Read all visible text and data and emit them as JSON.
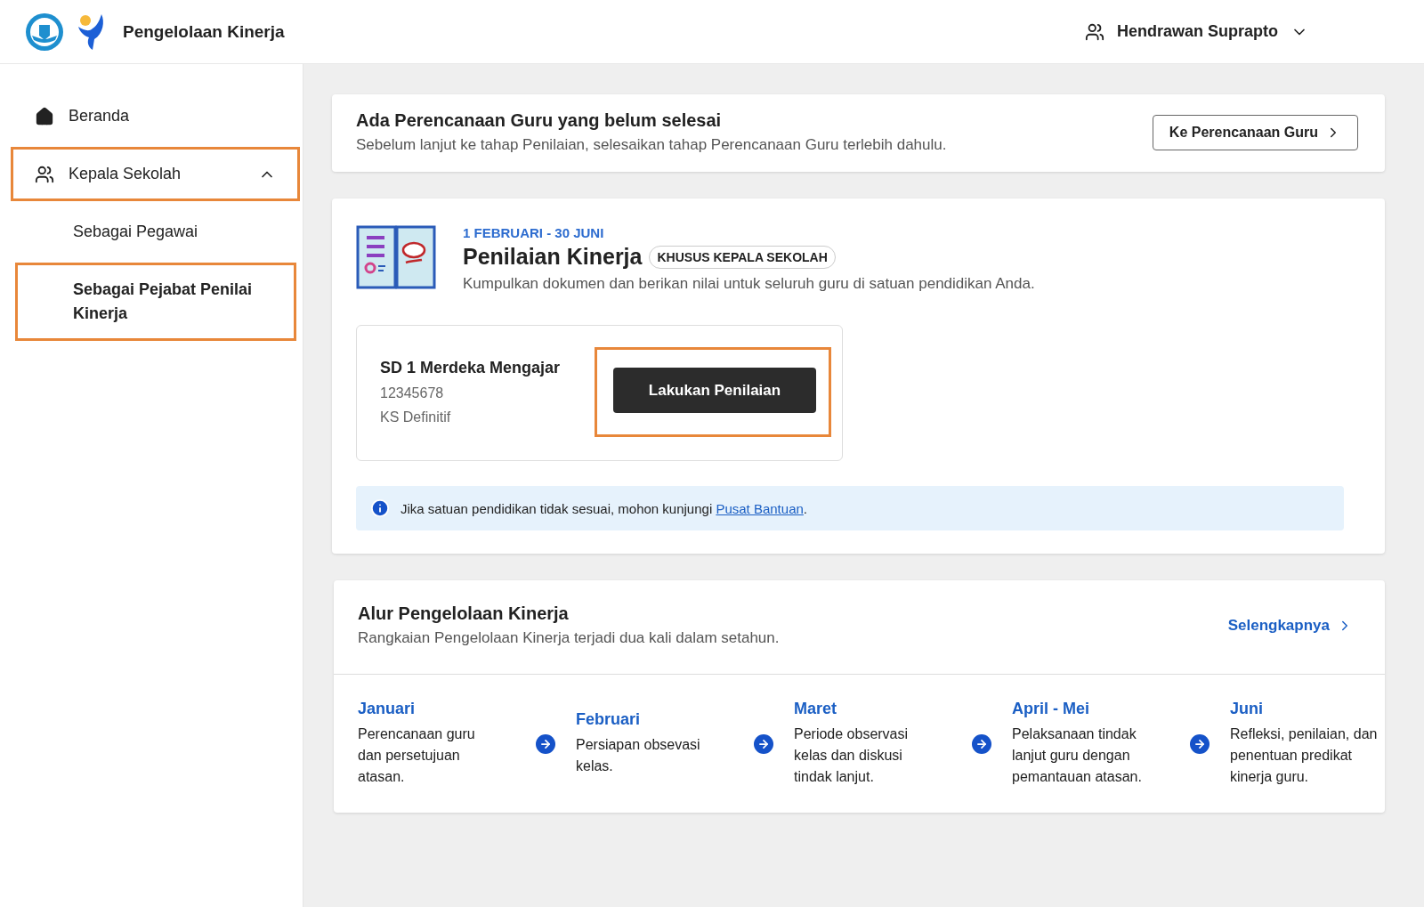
{
  "header": {
    "app_name": "Pengelolaan Kinerja",
    "user": "Hendrawan Suprapto"
  },
  "sidebar": {
    "items": [
      {
        "label": "Beranda",
        "kind": "home",
        "selected": false,
        "highlighted": false
      },
      {
        "label": "Kepala Sekolah",
        "kind": "group",
        "selected": false,
        "highlighted": true,
        "expanded": true,
        "children": [
          {
            "label": "Sebagai Pegawai",
            "selected": false,
            "highlighted": false
          },
          {
            "label": "Sebagai Pejabat Penilai Kinerja",
            "selected": true,
            "highlighted": true
          }
        ]
      }
    ]
  },
  "notice_card": {
    "title": "Ada Perencanaan Guru yang belum selesai",
    "text": "Sebelum lanjut ke tahap Penilaian, selesaikan tahap Perencanaan Guru terlebih dahulu.",
    "button": "Ke Perencanaan Guru"
  },
  "assessment_card": {
    "period": "1 FEBRUARI - 30 JUNI",
    "title": "Penilaian Kinerja",
    "badge": "KHUSUS KEPALA SEKOLAH",
    "description": "Kumpulkan dokumen dan berikan nilai untuk seluruh guru di satuan pendidikan Anda.",
    "school": {
      "name": "SD 1 Merdeka Mengajar",
      "id": "12345678",
      "role": "KS Definitif",
      "button": "Lakukan Penilaian",
      "button_highlighted": true
    },
    "info": {
      "text": "Jika satuan pendidikan tidak sesuai, mohon kunjungi ",
      "link": "Pusat Bantuan",
      "suffix": "."
    }
  },
  "flow_card": {
    "title": "Alur Pengelolaan Kinerja",
    "subtitle": "Rangkaian Pengelolaan Kinerja terjadi dua kali dalam setahun.",
    "link": "Selengkapnya",
    "steps": [
      {
        "month": "Januari",
        "text": "Perencanaan guru dan persetujuan atasan."
      },
      {
        "month": "Februari",
        "text": "Persiapan obsevasi kelas."
      },
      {
        "month": "Maret",
        "text": "Periode observasi kelas dan diskusi tindak lanjut."
      },
      {
        "month": "April - Mei",
        "text": "Pelaksanaan tindak lanjut guru dengan pemantauan atasan."
      },
      {
        "month": "Juni",
        "text": "Refleksi, penilaian, dan penentuan predikat kinerja guru."
      }
    ]
  }
}
